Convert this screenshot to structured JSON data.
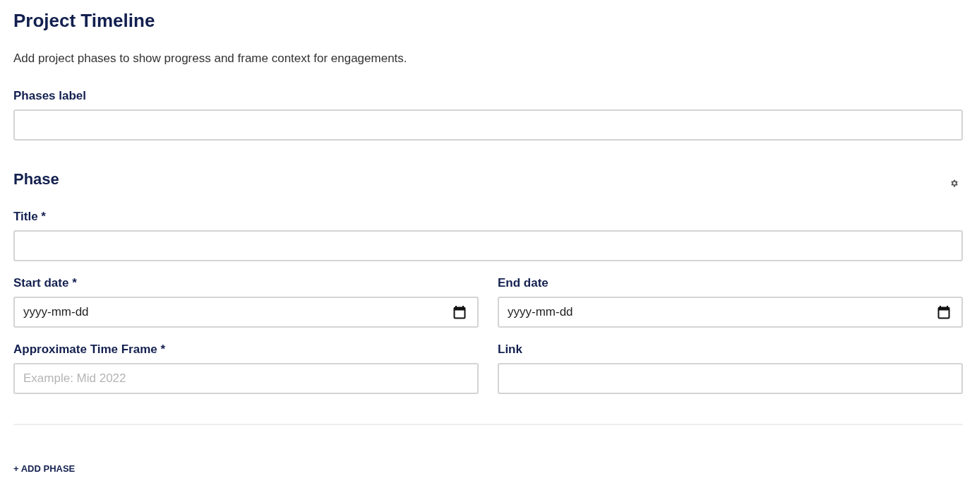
{
  "header": {
    "title": "Project Timeline",
    "description": "Add project phases to show progress and frame context for engagements."
  },
  "phases_label": {
    "label": "Phases label",
    "kind": "text"
  },
  "phase": {
    "heading": "Phase",
    "rows": [
      [
        {
          "label": "Title *",
          "kind": "text"
        }
      ],
      [
        {
          "label": "Start date *",
          "kind": "date",
          "value": "yyyy-mm-dd"
        },
        {
          "label": "End date",
          "kind": "date",
          "value": "yyyy-mm-dd"
        }
      ],
      [
        {
          "label": "Approximate Time Frame *",
          "kind": "text",
          "placeholder": "Example: Mid 2022"
        },
        {
          "label": "Link",
          "kind": "text"
        }
      ]
    ]
  },
  "add_button": "+ ADD PHASE"
}
